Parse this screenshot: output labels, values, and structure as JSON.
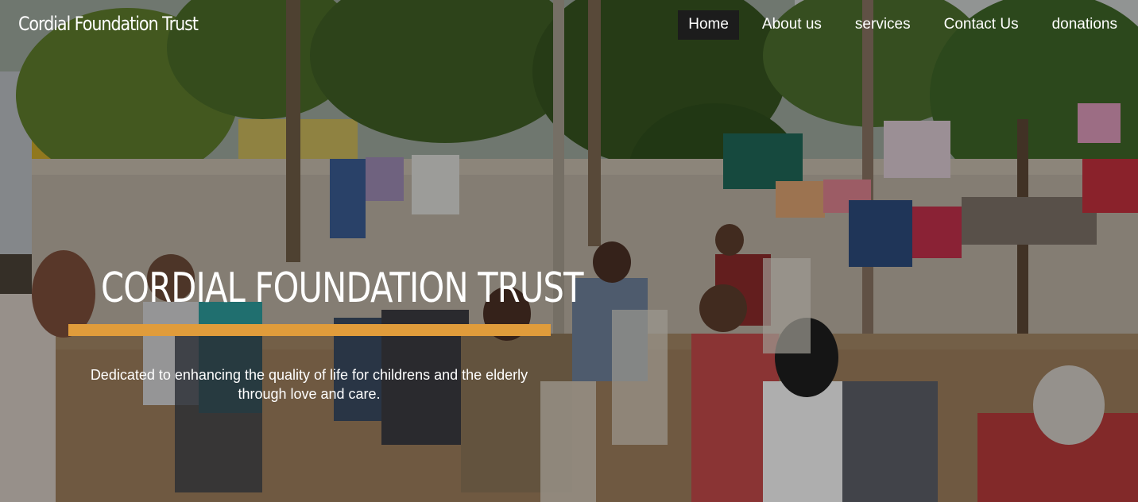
{
  "header": {
    "brand": "Cordial Foundation Trust",
    "nav": [
      {
        "label": "Home",
        "active": true
      },
      {
        "label": "About us",
        "active": false
      },
      {
        "label": "services",
        "active": false
      },
      {
        "label": "Contact Us",
        "active": false
      },
      {
        "label": "donations",
        "active": false
      }
    ]
  },
  "hero": {
    "title": "CORDIAL FOUNDATION TRUST",
    "tagline": "Dedicated to enhancing the quality of life for childrens and the elderly through love and care.",
    "photo": "people-eating-meals-outdoors-photo"
  },
  "colors": {
    "accent": "#e09c3b",
    "active_nav_bg": "#1c1c1c",
    "text": "#ffffff"
  }
}
